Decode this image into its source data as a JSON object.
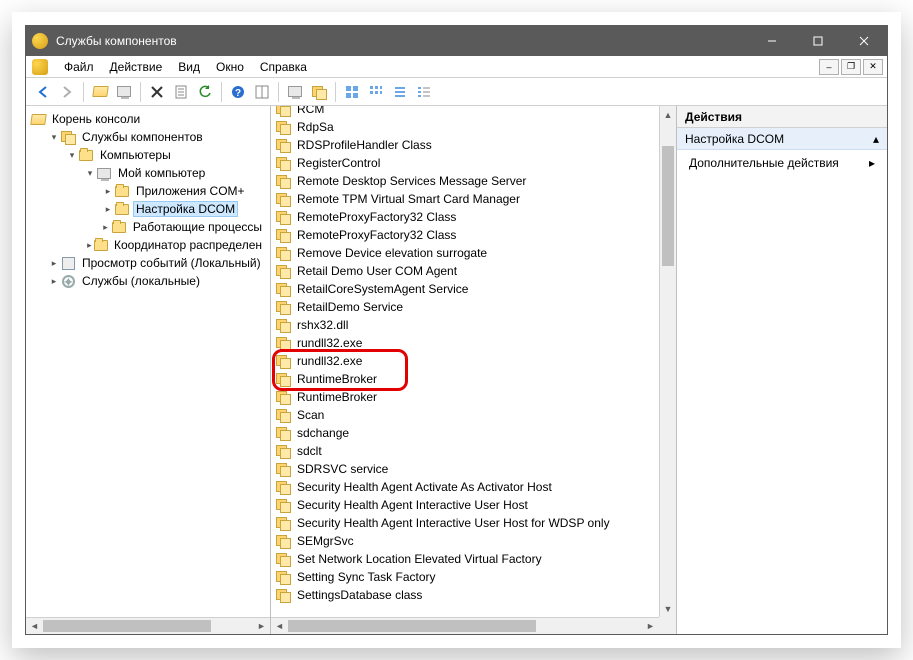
{
  "window": {
    "title": "Службы компонентов"
  },
  "menu": {
    "items": [
      "Файл",
      "Действие",
      "Вид",
      "Окно",
      "Справка"
    ]
  },
  "tree": {
    "root": "Корень консоли",
    "nodes": [
      {
        "label": "Службы компонентов",
        "icon": "comp",
        "depth": 1,
        "expanded": true
      },
      {
        "label": "Компьютеры",
        "icon": "folder",
        "depth": 2,
        "expanded": true
      },
      {
        "label": "Мой компьютер",
        "icon": "pc",
        "depth": 3,
        "expanded": true
      },
      {
        "label": "Приложения COM+",
        "icon": "folder",
        "depth": 4,
        "expanded": false,
        "twisty": true
      },
      {
        "label": "Настройка DCOM",
        "icon": "folder",
        "depth": 4,
        "expanded": false,
        "twisty": true,
        "selected": true
      },
      {
        "label": "Работающие процессы",
        "icon": "folder",
        "depth": 4,
        "expanded": false,
        "twisty": true
      },
      {
        "label": "Координатор распределен",
        "icon": "folder",
        "depth": 4,
        "expanded": false,
        "twisty": true
      },
      {
        "label": "Просмотр событий (Локальный)",
        "icon": "event",
        "depth": 1,
        "expanded": false,
        "twisty": true
      },
      {
        "label": "Службы (локальные)",
        "icon": "gear",
        "depth": 1,
        "expanded": false,
        "twisty": true
      }
    ]
  },
  "list": {
    "items": [
      "RCM",
      "RdpSa",
      "RDSProfileHandler Class",
      "RegisterControl",
      "Remote Desktop Services Message Server",
      "Remote TPM Virtual Smart Card Manager",
      "RemoteProxyFactory32 Class",
      "RemoteProxyFactory32 Class",
      "Remove Device elevation surrogate",
      "Retail Demo User COM Agent",
      "RetailCoreSystemAgent Service",
      "RetailDemo Service",
      "rshx32.dll",
      "rundll32.exe",
      "rundll32.exe",
      "RuntimeBroker",
      "RuntimeBroker",
      "Scan",
      "sdchange",
      "sdclt",
      "SDRSVC service",
      "Security Health Agent Activate As Activator Host",
      "Security Health Agent Interactive User Host",
      "Security Health Agent Interactive User Host for WDSP only",
      "SEMgrSvc",
      "Set Network Location Elevated Virtual Factory",
      "Setting Sync Task Factory",
      "SettingsDatabase class"
    ]
  },
  "actions": {
    "header": "Действия",
    "section": "Настройка DCOM",
    "more": "Дополнительные действия"
  }
}
